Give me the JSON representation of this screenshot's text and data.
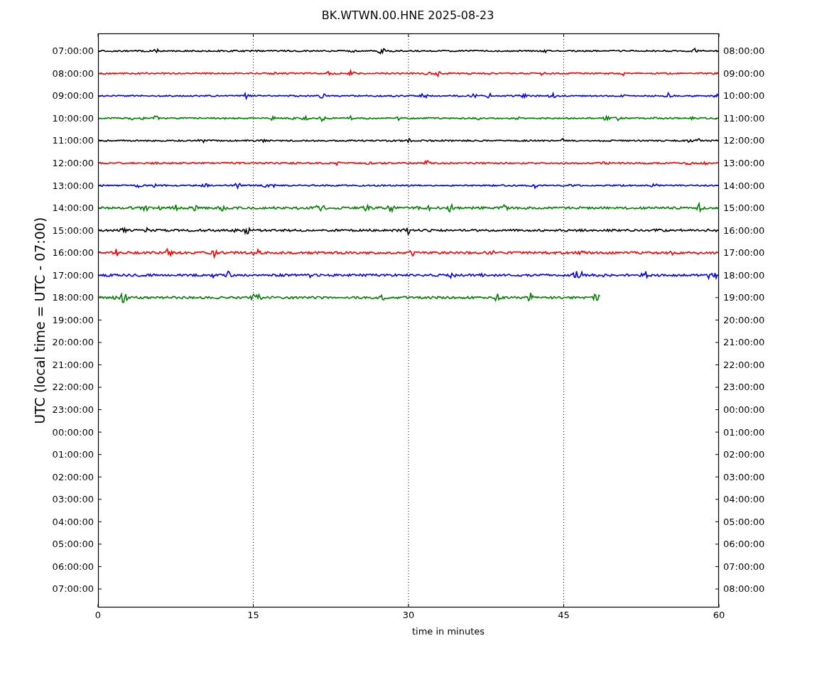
{
  "title": "BK.WTWN.00.HNE 2025-08-23",
  "ylabel": "UTC (local time = UTC - 07:00)",
  "xlabel": "time in minutes",
  "left_ticks": [
    "07:00:00",
    "08:00:00",
    "09:00:00",
    "10:00:00",
    "11:00:00",
    "12:00:00",
    "13:00:00",
    "14:00:00",
    "15:00:00",
    "16:00:00",
    "17:00:00",
    "18:00:00",
    "19:00:00",
    "20:00:00",
    "21:00:00",
    "22:00:00",
    "23:00:00",
    "00:00:00",
    "01:00:00",
    "02:00:00",
    "03:00:00",
    "04:00:00",
    "05:00:00",
    "06:00:00",
    "07:00:00"
  ],
  "right_ticks": [
    "08:00:00",
    "09:00:00",
    "10:00:00",
    "11:00:00",
    "12:00:00",
    "13:00:00",
    "14:00:00",
    "15:00:00",
    "16:00:00",
    "17:00:00",
    "18:00:00",
    "19:00:00",
    "20:00:00",
    "21:00:00",
    "22:00:00",
    "23:00:00",
    "00:00:00",
    "01:00:00",
    "02:00:00",
    "03:00:00",
    "04:00:00",
    "05:00:00",
    "06:00:00",
    "07:00:00",
    "08:00:00"
  ],
  "xticks": [
    "0",
    "15",
    "30",
    "45",
    "60"
  ],
  "traces": [
    {
      "color": "#000000",
      "level": 1
    },
    {
      "color": "#ff0000",
      "level": 1
    },
    {
      "color": "#0000ff",
      "level": 1
    },
    {
      "color": "#008000",
      "level": 1
    },
    {
      "color": "#000000",
      "level": 1
    },
    {
      "color": "#ff0000",
      "level": 1
    },
    {
      "color": "#0000ff",
      "level": 1
    },
    {
      "color": "#008000",
      "level": 1
    },
    {
      "color": "#000000",
      "level": 1
    },
    {
      "color": "#ff0000",
      "level": 1
    },
    {
      "color": "#0000ff",
      "level": 1
    },
    {
      "color": "#008000",
      "level": 0.81
    }
  ]
}
